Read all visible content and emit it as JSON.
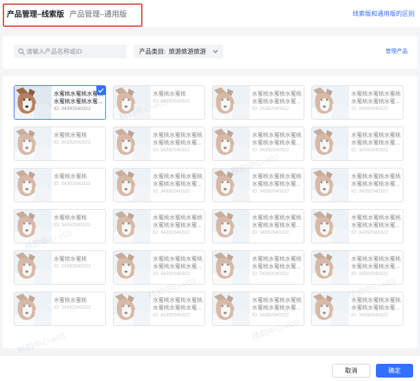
{
  "header": {
    "tabs": [
      {
        "label": "产品管理–线索版",
        "active": true
      },
      {
        "label": "产品管理–通用版",
        "active": false
      }
    ],
    "diff_link": "线索版和通用版的区别"
  },
  "filter": {
    "search_placeholder": "请输入产品名称或ID",
    "search_value": "",
    "category_label": "产品类目:",
    "category_value": "旅游旅游旅游",
    "manage_link": "管理产品"
  },
  "watermark": "精韵中心-e03",
  "products": [
    {
      "lines": [
        "水蜜桃水蜜桃水蜜桃",
        "水蜜桃水蜜桃水蜜..."
      ],
      "id": "ID: 34392040322",
      "selected": true
    },
    {
      "lines": [
        "水蜜桃水蜜桃"
      ],
      "id": "ID: 34392040322",
      "selected": false
    },
    {
      "lines": [
        "水蜜桃水蜜桃水蜜桃",
        "水蜜桃水蜜桃水蜜..."
      ],
      "id": "ID: 34392040322",
      "selected": false
    },
    {
      "lines": [
        "水蜜桃水蜜桃水蜜桃",
        "水蜜桃水蜜桃水蜜..."
      ],
      "id": "ID: 34392040322",
      "selected": false
    },
    {
      "lines": [
        "水蜜桃水蜜桃"
      ],
      "id": "ID: 34392040322",
      "selected": false
    },
    {
      "lines": [
        "水蜜桃水蜜桃水蜜桃",
        "水蜜桃水蜜桃水蜜..."
      ],
      "id": "ID: 34392040322",
      "selected": false
    },
    {
      "lines": [
        "水蜜桃水蜜桃水蜜桃",
        "水蜜桃水蜜桃水蜜..."
      ],
      "id": "ID: 34392040322",
      "selected": false
    },
    {
      "lines": [
        "水蜜桃水蜜桃水蜜桃",
        "水蜜桃水蜜桃水蜜..."
      ],
      "id": "ID: 34392040322",
      "selected": false
    },
    {
      "lines": [
        "水蜜桃水蜜桃"
      ],
      "id": "ID: 34392040322",
      "selected": false
    },
    {
      "lines": [
        "水蜜桃水蜜桃水蜜桃",
        "水蜜桃水蜜桃水蜜..."
      ],
      "id": "ID: 34392040322",
      "selected": false
    },
    {
      "lines": [
        "水蜜桃水蜜桃水蜜桃",
        "水蜜桃水蜜桃水蜜..."
      ],
      "id": "ID: 34392040322",
      "selected": false
    },
    {
      "lines": [
        "水蜜桃水蜜桃水蜜桃",
        "水蜜桃水蜜桃水蜜..."
      ],
      "id": "ID: 34392040322",
      "selected": false
    },
    {
      "lines": [
        "水蜜桃水蜜桃"
      ],
      "id": "ID: 34392040322",
      "selected": false
    },
    {
      "lines": [
        "水蜜桃水蜜桃水蜜桃",
        "水蜜桃水蜜桃水蜜..."
      ],
      "id": "ID: 34392040322",
      "selected": false
    },
    {
      "lines": [
        "水蜜桃水蜜桃水蜜桃",
        "水蜜桃水蜜桃水蜜..."
      ],
      "id": "ID: 34392040322",
      "selected": false
    },
    {
      "lines": [
        "水蜜桃水蜜桃水蜜桃",
        "水蜜桃水蜜桃水蜜..."
      ],
      "id": "ID: 34392040322",
      "selected": false
    },
    {
      "lines": [
        "水蜜桃水蜜桃"
      ],
      "id": "ID: 34392040322",
      "selected": false
    },
    {
      "lines": [
        "水蜜桃水蜜桃水蜜桃",
        "水蜜桃水蜜桃水蜜..."
      ],
      "id": "ID: 34392040322",
      "selected": false
    },
    {
      "lines": [
        "水蜜桃水蜜桃水蜜桃",
        "水蜜桃水蜜桃水蜜..."
      ],
      "id": "ID: 34392040322",
      "selected": false
    },
    {
      "lines": [
        "水蜜桃水蜜桃水蜜桃",
        "水蜜桃水蜜桃水蜜..."
      ],
      "id": "ID: 34392040322",
      "selected": false
    },
    {
      "lines": [
        "水蜜桃水蜜桃"
      ],
      "id": "ID: 34392040322",
      "selected": false
    },
    {
      "lines": [
        "水蜜桃水蜜桃水蜜桃",
        "水蜜桃水蜜桃水蜜..."
      ],
      "id": "ID: 34392040322",
      "selected": false
    },
    {
      "lines": [
        "水蜜桃水蜜桃水蜜桃",
        "水蜜桃水蜜桃水蜜..."
      ],
      "id": "ID: 34392040322",
      "selected": false
    },
    {
      "lines": [
        "水蜜桃水蜜桃水蜜桃",
        "水蜜桃水蜜桃水蜜..."
      ],
      "id": "ID: 34392040322",
      "selected": false
    }
  ],
  "footer": {
    "cancel_label": "取消",
    "confirm_label": "确定"
  },
  "colors": {
    "accent": "#3370ff",
    "highlight_border": "#d9534f"
  }
}
